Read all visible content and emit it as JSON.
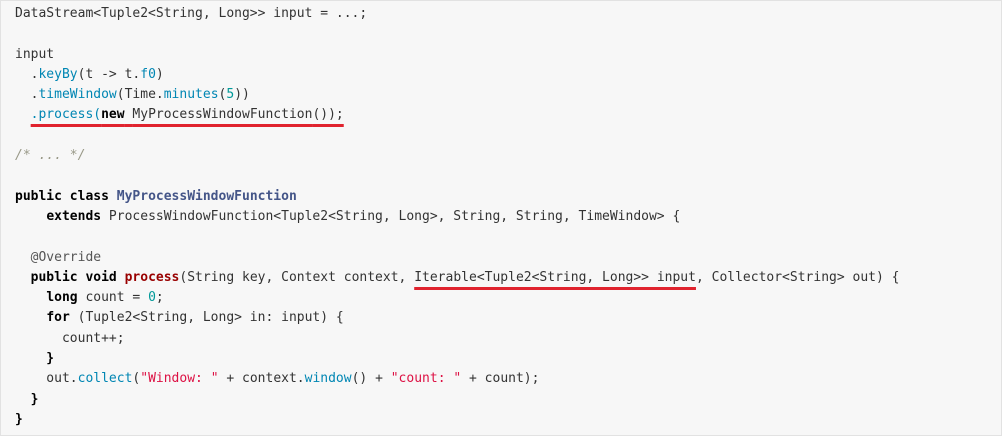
{
  "code": {
    "l01": [
      "DataStream<Tuple2<String, Long>> input = ...;"
    ],
    "l03": [
      "input"
    ],
    "l04": [
      "  .",
      "keyBy",
      "(t -> t.",
      "f0",
      ")"
    ],
    "l05": [
      "  .",
      "timeWindow",
      "(Time.",
      "minutes",
      "(",
      "5",
      "))"
    ],
    "l06": [
      "  ",
      ".process(",
      "new",
      " ",
      "MyProcessWindowFunction",
      "());"
    ],
    "l08": [
      "/* ... */"
    ],
    "l10": [
      "public",
      " ",
      "class",
      " ",
      "MyProcessWindowFunction"
    ],
    "l11": [
      "    ",
      "extends",
      " ProcessWindowFunction<Tuple2<String, Long>, String, String, TimeWindow> {"
    ],
    "l13": [
      "  @Override"
    ],
    "l14": [
      "  ",
      "public",
      " ",
      "void",
      " ",
      "process",
      "(String key, Context context, ",
      "Iterable<Tuple2<String, Long>> input",
      ", Collector<String> out) {"
    ],
    "l15": [
      "    ",
      "long",
      " count = ",
      "0",
      ";"
    ],
    "l16": [
      "    ",
      "for",
      " (Tuple2<String, Long> in: input) {"
    ],
    "l17": [
      "      count++;"
    ],
    "l18": [
      "    }"
    ],
    "l19": [
      "    out.",
      "collect",
      "(",
      "\"Window: \"",
      " + context.",
      "window",
      "() + ",
      "\"count: \"",
      " + count);"
    ],
    "l20": [
      "  }"
    ],
    "l21": [
      "}"
    ]
  },
  "colors": {
    "background": "#f7f7f7",
    "keyword": "#000000",
    "class_name": "#445588",
    "method": "#0086b3",
    "number": "#009999",
    "string": "#dd1144",
    "comment": "#999988",
    "underline_highlight": "#e0232e"
  }
}
